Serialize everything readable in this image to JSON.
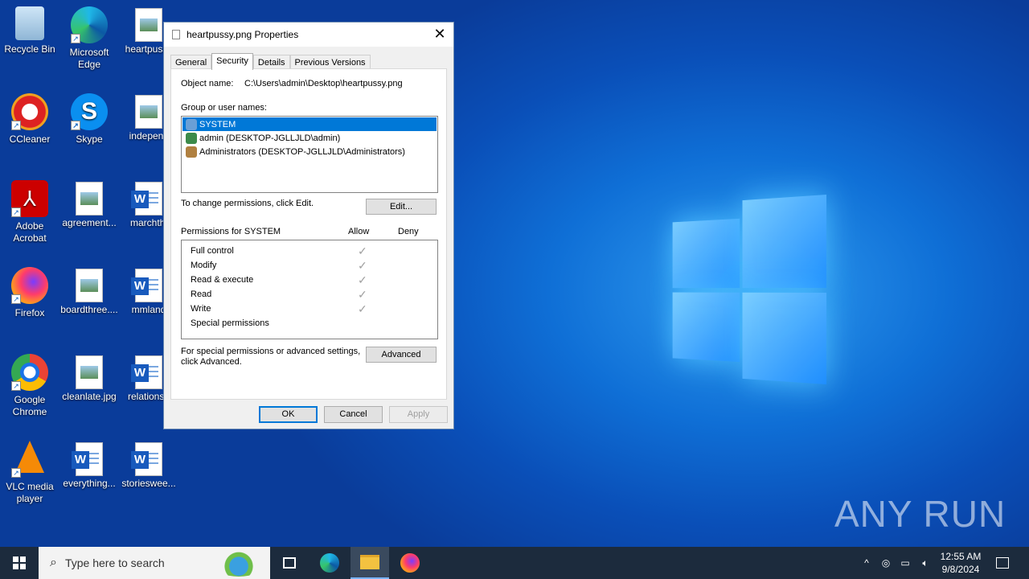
{
  "desktop_icons": [
    {
      "label": "Recycle Bin"
    },
    {
      "label": "Microsoft Edge"
    },
    {
      "label": "heartpussy"
    },
    {
      "label": "CCleaner"
    },
    {
      "label": "Skype"
    },
    {
      "label": "indepenc"
    },
    {
      "label": "Adobe Acrobat"
    },
    {
      "label": "agreement..."
    },
    {
      "label": "marchthi"
    },
    {
      "label": "Firefox"
    },
    {
      "label": "boardthree...."
    },
    {
      "label": "mmland"
    },
    {
      "label": "Google Chrome"
    },
    {
      "label": "cleanlate.jpg"
    },
    {
      "label": "relationsh"
    },
    {
      "label": "VLC media player"
    },
    {
      "label": "everything..."
    },
    {
      "label": "storieswee..."
    }
  ],
  "dialog": {
    "title": "heartpussy.png Properties",
    "close": "✕",
    "tabs": [
      "General",
      "Security",
      "Details",
      "Previous Versions"
    ],
    "object_name_label": "Object name:",
    "object_name_value": "C:\\Users\\admin\\Desktop\\heartpussy.png",
    "group_label": "Group or user names:",
    "users": [
      "SYSTEM",
      "admin (DESKTOP-JGLLJLD\\admin)",
      "Administrators (DESKTOP-JGLLJLD\\Administrators)"
    ],
    "change_text": "To change permissions, click Edit.",
    "edit_button": "Edit...",
    "permissions_for": "Permissions for SYSTEM",
    "allow": "Allow",
    "deny": "Deny",
    "permissions": [
      {
        "name": "Full control",
        "allow": true
      },
      {
        "name": "Modify",
        "allow": true
      },
      {
        "name": "Read & execute",
        "allow": true
      },
      {
        "name": "Read",
        "allow": true
      },
      {
        "name": "Write",
        "allow": true
      },
      {
        "name": "Special permissions",
        "allow": false
      }
    ],
    "check_glyph": "✓",
    "special_text_1": "For special permissions or advanced settings,",
    "special_text_2": "click Advanced.",
    "advanced_button": "Advanced",
    "ok": "OK",
    "cancel": "Cancel",
    "apply": "Apply"
  },
  "taskbar": {
    "search_placeholder": "Type here to search",
    "time": "12:55 AM",
    "date": "9/8/2024"
  },
  "watermark": "ANY RUN"
}
